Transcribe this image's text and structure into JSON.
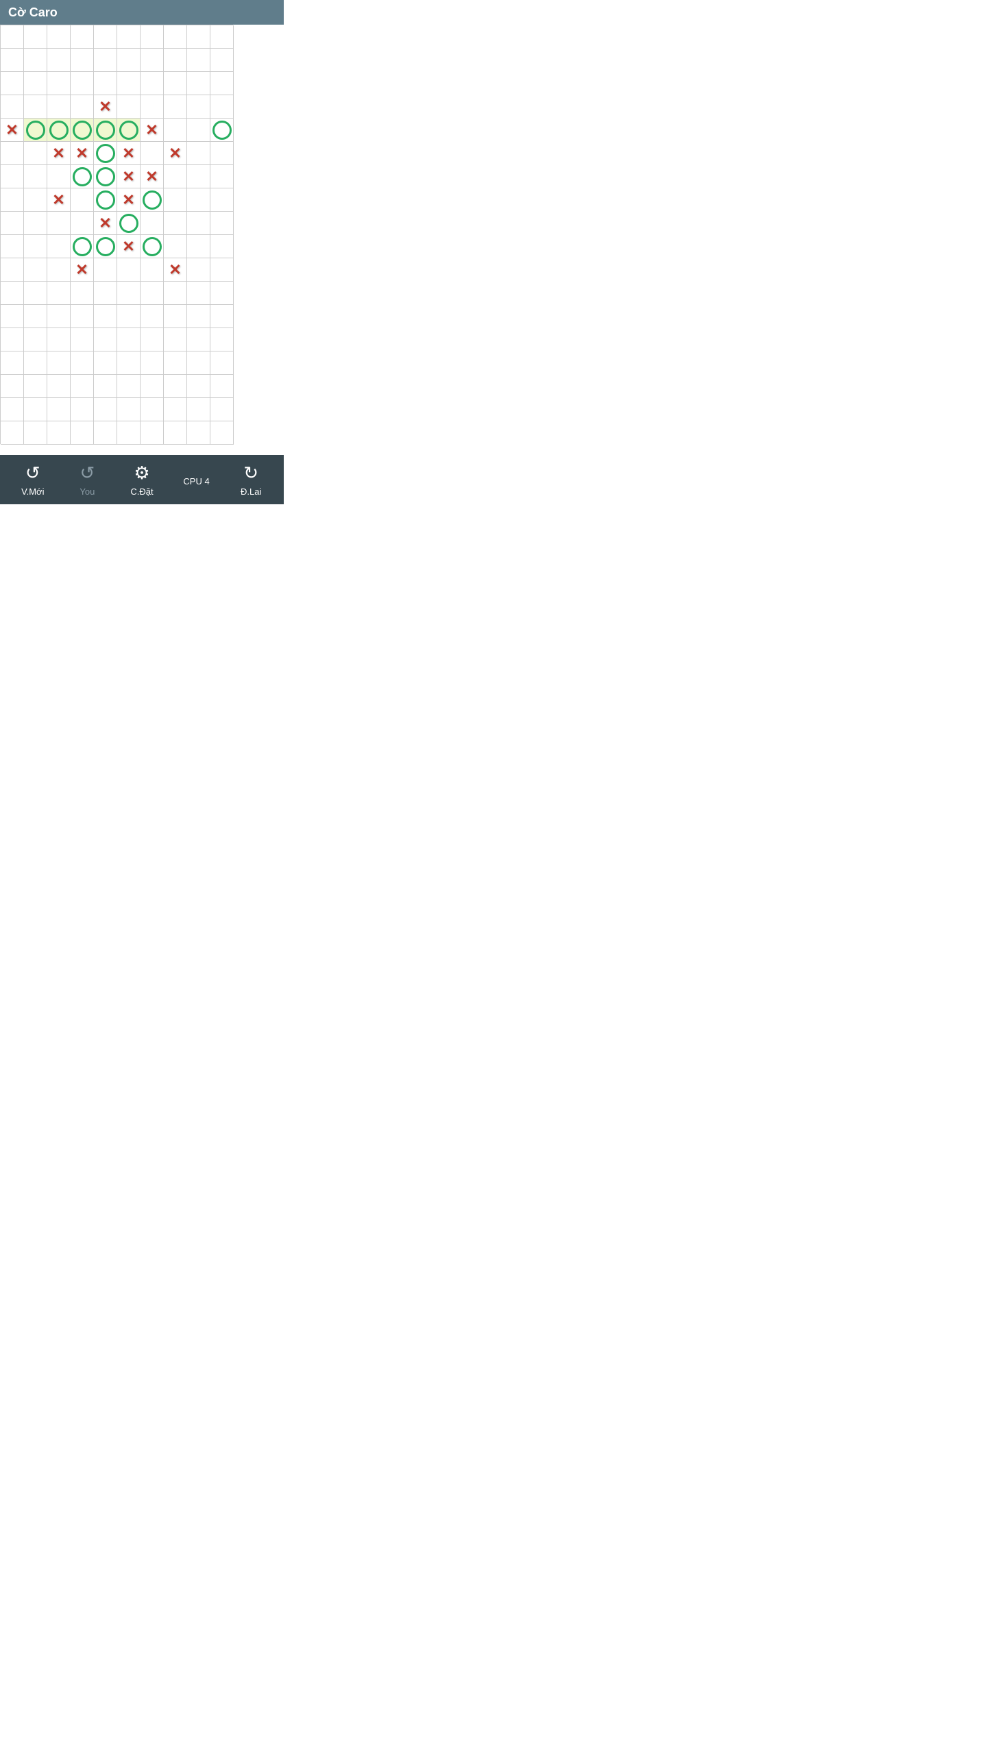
{
  "header": {
    "title": "Cờ Caro"
  },
  "board": {
    "cols": 10,
    "rows": 18,
    "cells": [
      {
        "row": 4,
        "col": 5,
        "piece": "X",
        "highlight": false
      },
      {
        "row": 5,
        "col": 1,
        "piece": "X",
        "highlight": false
      },
      {
        "row": 5,
        "col": 2,
        "piece": "O",
        "highlight": true
      },
      {
        "row": 5,
        "col": 3,
        "piece": "O",
        "highlight": true
      },
      {
        "row": 5,
        "col": 4,
        "piece": "O",
        "highlight": true
      },
      {
        "row": 5,
        "col": 5,
        "piece": "O",
        "highlight": true
      },
      {
        "row": 5,
        "col": 6,
        "piece": "O",
        "highlight": true
      },
      {
        "row": 5,
        "col": 7,
        "piece": "X",
        "highlight": false
      },
      {
        "row": 5,
        "col": 10,
        "piece": "O",
        "highlight": false
      },
      {
        "row": 6,
        "col": 3,
        "piece": "X",
        "highlight": false
      },
      {
        "row": 6,
        "col": 4,
        "piece": "X",
        "highlight": false
      },
      {
        "row": 6,
        "col": 5,
        "piece": "O",
        "highlight": false
      },
      {
        "row": 6,
        "col": 6,
        "piece": "X",
        "highlight": false
      },
      {
        "row": 6,
        "col": 8,
        "piece": "X",
        "highlight": false
      },
      {
        "row": 7,
        "col": 4,
        "piece": "O",
        "highlight": false
      },
      {
        "row": 7,
        "col": 5,
        "piece": "O",
        "highlight": false
      },
      {
        "row": 7,
        "col": 6,
        "piece": "X",
        "highlight": false
      },
      {
        "row": 7,
        "col": 7,
        "piece": "X",
        "highlight": false
      },
      {
        "row": 8,
        "col": 3,
        "piece": "X",
        "highlight": false
      },
      {
        "row": 8,
        "col": 5,
        "piece": "O",
        "highlight": false
      },
      {
        "row": 8,
        "col": 6,
        "piece": "X",
        "highlight": false
      },
      {
        "row": 8,
        "col": 7,
        "piece": "O",
        "highlight": false
      },
      {
        "row": 9,
        "col": 5,
        "piece": "X",
        "highlight": false
      },
      {
        "row": 9,
        "col": 6,
        "piece": "O",
        "highlight": false
      },
      {
        "row": 10,
        "col": 4,
        "piece": "O",
        "highlight": false
      },
      {
        "row": 10,
        "col": 5,
        "piece": "O",
        "highlight": false
      },
      {
        "row": 10,
        "col": 6,
        "piece": "X",
        "highlight": false
      },
      {
        "row": 10,
        "col": 7,
        "piece": "O",
        "highlight": false
      },
      {
        "row": 11,
        "col": 4,
        "piece": "X",
        "highlight": false
      },
      {
        "row": 11,
        "col": 8,
        "piece": "X",
        "highlight": false
      }
    ]
  },
  "footer": {
    "buttons": [
      {
        "id": "new",
        "label": "V.Mới",
        "icon": "arrow-left",
        "dimmed": false
      },
      {
        "id": "you",
        "label": "You",
        "icon": "arrow-left-dimmed",
        "dimmed": true
      },
      {
        "id": "settings",
        "label": "C.Đặt",
        "icon": "gear",
        "dimmed": false
      },
      {
        "id": "cpu",
        "label": "CPU 4",
        "icon": "green-circle",
        "dimmed": false
      },
      {
        "id": "undo",
        "label": "Đ.Lai",
        "icon": "arrow-right",
        "dimmed": false
      }
    ]
  }
}
